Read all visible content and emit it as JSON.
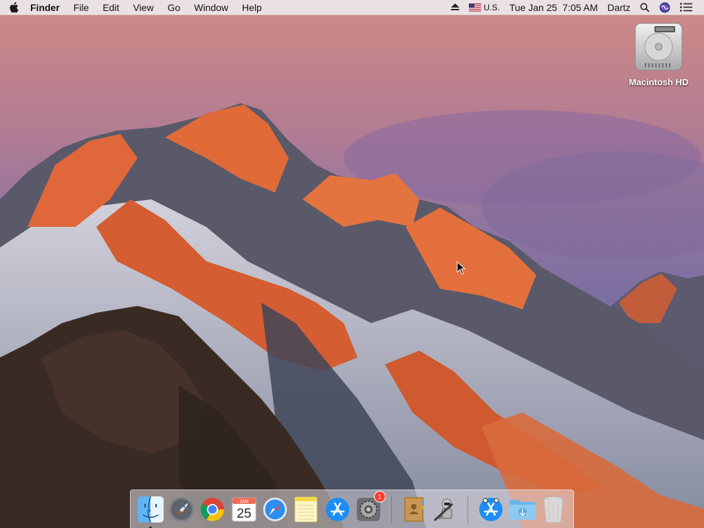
{
  "menubar": {
    "app_name": "Finder",
    "menus": [
      "File",
      "Edit",
      "View",
      "Go",
      "Window",
      "Help"
    ],
    "input_source": "U.S.",
    "clock": "Tue Jan 25  7:05 AM",
    "user": "Dartz"
  },
  "desktop": {
    "icons": [
      {
        "label": "Macintosh HD",
        "icon": "hard-drive-icon"
      }
    ]
  },
  "dock": {
    "apps": [
      {
        "name": "finder-icon",
        "running": true
      },
      {
        "name": "launchpad-icon",
        "running": false
      },
      {
        "name": "chrome-icon",
        "running": false
      },
      {
        "name": "calendar-icon",
        "running": false,
        "month": "JAN",
        "day": "25"
      },
      {
        "name": "safari-icon",
        "running": false
      },
      {
        "name": "notes-icon",
        "running": false
      },
      {
        "name": "app-store-icon",
        "running": false
      },
      {
        "name": "system-preferences-icon",
        "running": false,
        "badge": "1"
      },
      {
        "name": "contacts-icon",
        "running": false
      },
      {
        "name": "automator-icon",
        "running": false
      },
      {
        "name": "app-store-folder-icon",
        "running": false
      },
      {
        "name": "downloads-folder-icon",
        "running": false
      },
      {
        "name": "trash-icon",
        "running": false
      }
    ]
  }
}
